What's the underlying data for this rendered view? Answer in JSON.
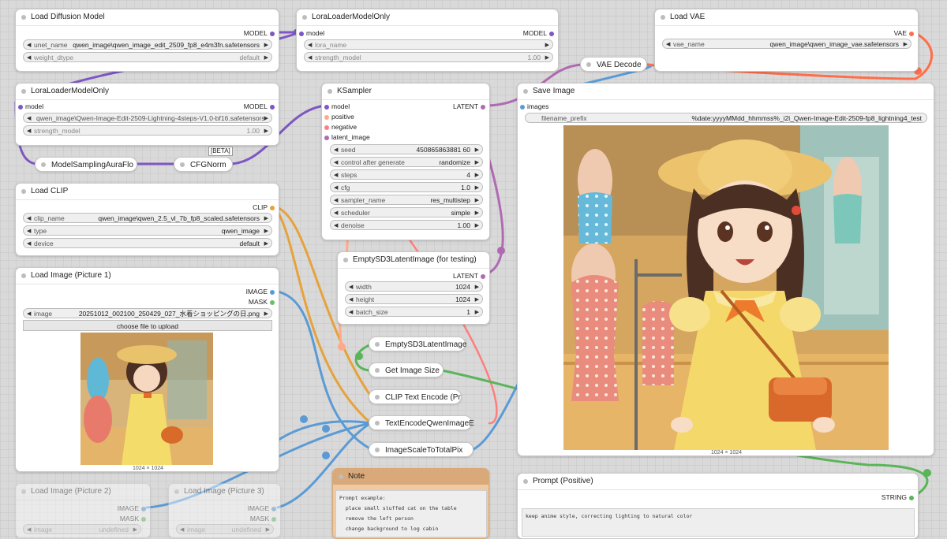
{
  "colors": {
    "model": "#7e57c2",
    "clip": "#e6a23c",
    "vae": "#ff6e4a",
    "latent": "#b06ab3",
    "image": "#5b9bd5",
    "mask": "#6abf69",
    "conditioning": "#ffa98a",
    "string": "#5ab55a"
  },
  "nodes": {
    "load_diffusion": {
      "title": "Load Diffusion Model",
      "out_model": "MODEL",
      "unet_label": "unet_name",
      "unet_value": "qwen_image\\qwen_image_edit_2509_fp8_e4m3fn.safetensors",
      "dtype_label": "weight_dtype",
      "dtype_value": "default"
    },
    "lora_top": {
      "title": "LoraLoaderModelOnly",
      "in_model": "model",
      "out_model": "MODEL",
      "lora_label": "lora_name",
      "strength_label": "strength_model",
      "strength_value": "1.00"
    },
    "lora_left": {
      "title": "LoraLoaderModelOnly",
      "in_model": "model",
      "out_model": "MODEL",
      "lora_value": "qwen_image\\Qwen-Image-Edit-2509-Lightning-4steps-V1.0-bf16.safetensors",
      "strength_label": "strength_model",
      "strength_value": "1.00"
    },
    "model_sampling": {
      "title": "ModelSamplingAuraFlo"
    },
    "cfgnorm": {
      "title": "CFGNorm",
      "badge": "[BETA]"
    },
    "load_clip": {
      "title": "Load CLIP",
      "out_clip": "CLIP",
      "clip_label": "clip_name",
      "clip_value": "qwen_image\\qwen_2.5_vl_7b_fp8_scaled.safetensors",
      "type_label": "type",
      "type_value": "qwen_image",
      "device_label": "device",
      "device_value": "default"
    },
    "load_image1": {
      "title": "Load Image (Picture 1)",
      "out_image": "IMAGE",
      "out_mask": "MASK",
      "image_label": "image",
      "image_value": "20251012_002100_250429_027_水着ショッピングの日.png",
      "upload_label": "choose file to upload",
      "caption": "1024 × 1024"
    },
    "load_image2": {
      "title": "Load Image (Picture 2)",
      "out_image": "IMAGE",
      "out_mask": "MASK",
      "image_label": "image",
      "image_value": "undefined"
    },
    "load_image3": {
      "title": "Load Image (Picture 3)",
      "out_image": "IMAGE",
      "out_mask": "MASK",
      "image_label": "image",
      "image_value": "undefined"
    },
    "vae_loader": {
      "title": "Load VAE",
      "out_vae": "VAE",
      "vae_label": "vae_name",
      "vae_value": "qwen_image\\qwen_image_vae.safetensors"
    },
    "vae_decode": {
      "title": "VAE Decode"
    },
    "ksampler": {
      "title": "KSampler",
      "in_model": "model",
      "in_positive": "positive",
      "in_negative": "negative",
      "in_latent": "latent_image",
      "out_latent": "LATENT",
      "widgets": [
        {
          "label": "seed",
          "value": "450865863881 60"
        },
        {
          "label": "control after generate",
          "value": "randomize"
        },
        {
          "label": "steps",
          "value": "4"
        },
        {
          "label": "cfg",
          "value": "1.0"
        },
        {
          "label": "sampler_name",
          "value": "res_multistep"
        },
        {
          "label": "scheduler",
          "value": "simple"
        },
        {
          "label": "denoise",
          "value": "1.00"
        }
      ]
    },
    "empty_sd3": {
      "title": "EmptySD3LatentImage (for testing)",
      "out_latent": "LATENT",
      "widgets": [
        {
          "label": "width",
          "value": "1024"
        },
        {
          "label": "height",
          "value": "1024"
        },
        {
          "label": "batch_size",
          "value": "1"
        }
      ]
    },
    "collapsed": [
      "EmptySD3LatentImage",
      "Get Image Size",
      "CLIP Text Encode (Pr",
      "TextEncodeQwenImageE",
      "ImageScaleToTotalPix"
    ],
    "save_image": {
      "title": "Save Image",
      "in_images": "images",
      "prefix_label": "filename_prefix",
      "prefix_value": "%date:yyyyMMdd_hhmmss%_i2i_Qwen-Image-Edit-2509-fp8_lightning4_test",
      "caption": "1024 × 1024"
    },
    "note": {
      "title": "Note",
      "lines": [
        "Prompt example:",
        "  place small stuffed cat on the table",
        "  remove the left person",
        "  change background to log cabin"
      ]
    },
    "prompt_positive": {
      "title": "Prompt (Positive)",
      "out_string": "STRING",
      "text": "keep anime style, correcting lighting to natural color"
    }
  }
}
